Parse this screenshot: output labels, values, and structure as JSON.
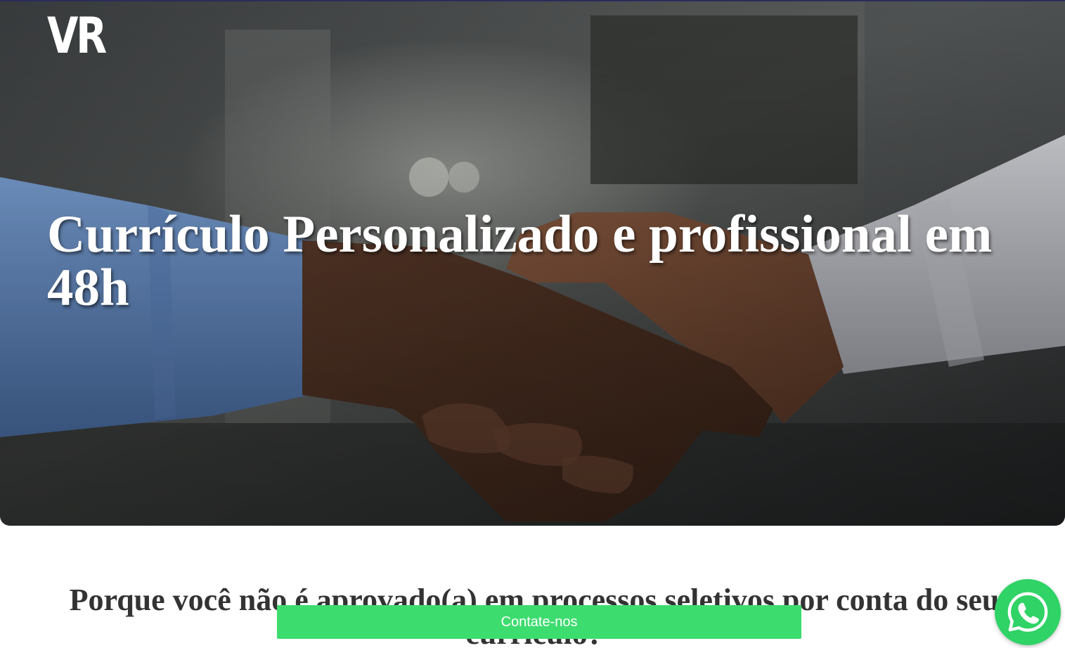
{
  "header": {
    "logo_text": "VR"
  },
  "hero": {
    "title": "Currículo Personalizado e profissional em 48h",
    "image_description_icon": "handshake-photo"
  },
  "section": {
    "heading": "Porque você não é aprovado(a) em processos seletivos por conta do seu currículo?"
  },
  "cta": {
    "contact_label": "Contate-nos",
    "whatsapp_icon": "whatsapp-icon"
  },
  "colors": {
    "contact_button": "#3ddc6f",
    "whatsapp": "#2fd366",
    "heading_text": "#333333",
    "hero_text": "#ffffff"
  }
}
